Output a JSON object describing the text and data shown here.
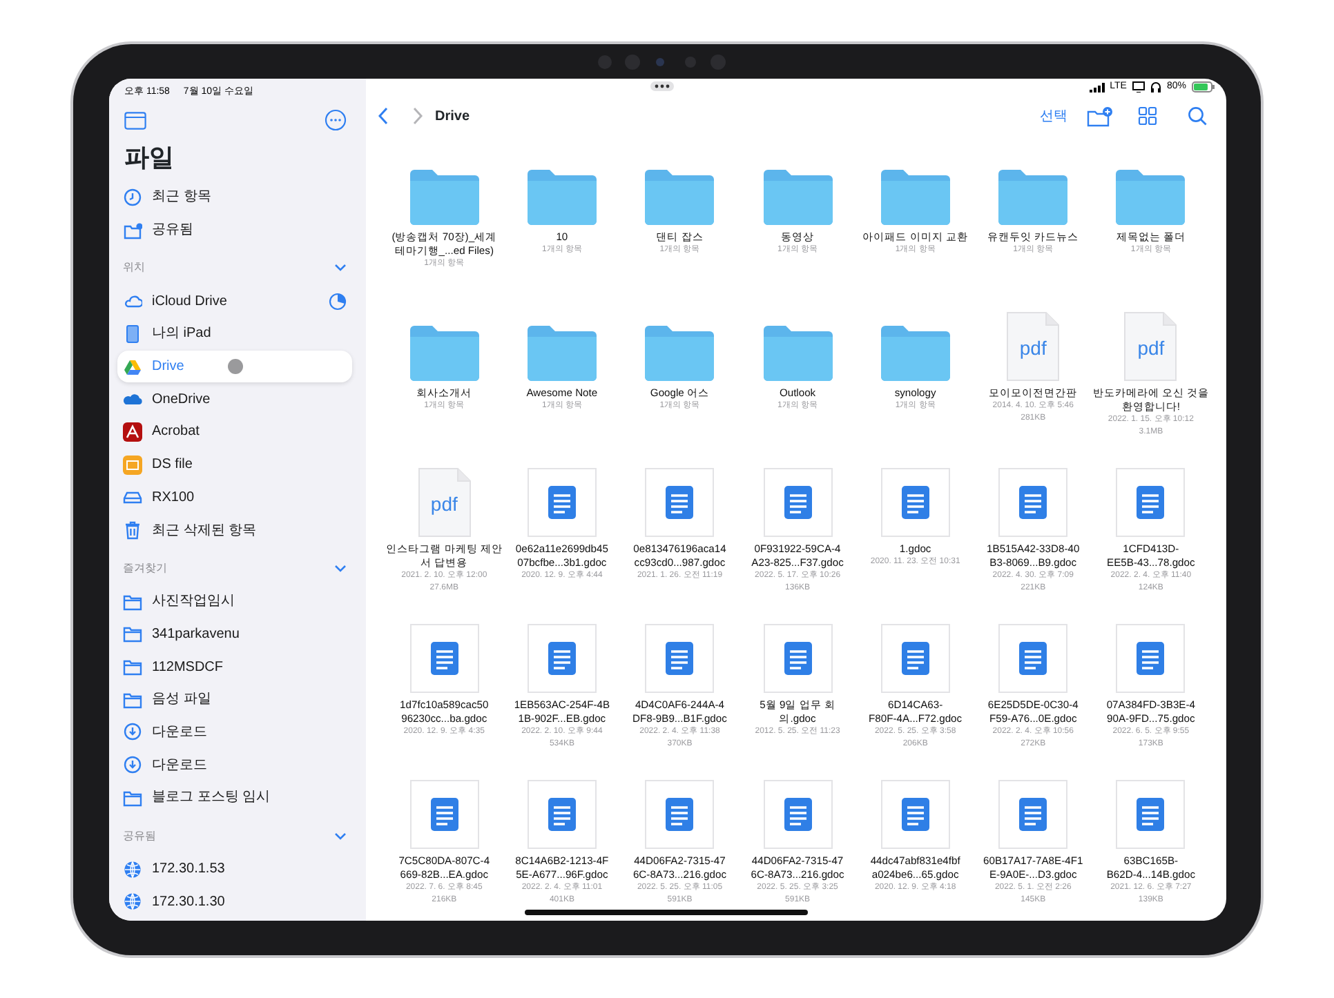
{
  "status_bar": {
    "time": "오후 11:58",
    "date": "7월 10일 수요일",
    "network": "LTE",
    "battery": "80%"
  },
  "sidebar": {
    "title": "파일",
    "top_items": [
      {
        "label": "최근 항목",
        "kind": "clock",
        "selected": false
      },
      {
        "label": "공유됨",
        "kind": "shared",
        "selected": false
      }
    ],
    "sections": [
      {
        "title": "위치",
        "expanded": true,
        "items": [
          {
            "label": "iCloud Drive",
            "kind": "icloud",
            "selected": false
          },
          {
            "label": "나의 iPad",
            "kind": "ipad",
            "selected": false
          },
          {
            "label": "Drive",
            "kind": "gdrive",
            "selected": true
          },
          {
            "label": "OneDrive",
            "kind": "onedrive",
            "selected": false
          },
          {
            "label": "Acrobat",
            "kind": "acrobat",
            "selected": false
          },
          {
            "label": "DS file",
            "kind": "dsfile",
            "selected": false
          },
          {
            "label": "RX100",
            "kind": "disk",
            "selected": false
          },
          {
            "label": "최근 삭제된 항목",
            "kind": "trash",
            "selected": false
          }
        ]
      },
      {
        "title": "즐겨찾기",
        "expanded": true,
        "items": [
          {
            "label": "사진작업임시",
            "kind": "folder",
            "selected": false
          },
          {
            "label": "341parkavenu",
            "kind": "folder",
            "selected": false
          },
          {
            "label": "112MSDCF",
            "kind": "folder",
            "selected": false
          },
          {
            "label": "음성 파일",
            "kind": "folder",
            "selected": false
          },
          {
            "label": "다운로드",
            "kind": "download",
            "selected": false
          },
          {
            "label": "다운로드",
            "kind": "download",
            "selected": false
          },
          {
            "label": "블로그 포스팅 임시",
            "kind": "folder",
            "selected": false
          }
        ]
      },
      {
        "title": "공유됨",
        "expanded": true,
        "items": [
          {
            "label": "172.30.1.53",
            "kind": "globe",
            "selected": false
          },
          {
            "label": "172.30.1.30",
            "kind": "globe",
            "selected": false
          }
        ]
      }
    ]
  },
  "toolbar": {
    "title": "Drive",
    "select_label": "선택"
  },
  "files": [
    {
      "kind": "folder",
      "name_lines": [
        "(방송캡처 70장)_세계",
        "테마기행_...ed Files)"
      ],
      "meta": [
        "1개의 항목"
      ]
    },
    {
      "kind": "folder",
      "name_lines": [
        "10"
      ],
      "meta": [
        "1개의 항목"
      ]
    },
    {
      "kind": "folder",
      "name_lines": [
        "댄티 잡스"
      ],
      "meta": [
        "1개의 항목"
      ]
    },
    {
      "kind": "folder",
      "name_lines": [
        "동영상"
      ],
      "meta": [
        "1개의 항목"
      ]
    },
    {
      "kind": "folder",
      "name_lines": [
        "아이패드 이미지 교환"
      ],
      "meta": [
        "1개의 항목"
      ]
    },
    {
      "kind": "folder",
      "name_lines": [
        "유캔두잇 카드뉴스"
      ],
      "meta": [
        "1개의 항목"
      ]
    },
    {
      "kind": "folder",
      "name_lines": [
        "제목없는 폴더"
      ],
      "meta": [
        "1개의 항목"
      ]
    },
    {
      "kind": "folder",
      "name_lines": [
        "회사소개서"
      ],
      "meta": [
        "1개의 항목"
      ]
    },
    {
      "kind": "folder",
      "name_lines": [
        "Awesome Note"
      ],
      "meta": [
        "1개의 항목"
      ]
    },
    {
      "kind": "folder",
      "name_lines": [
        "Google 어스"
      ],
      "meta": [
        "1개의 항목"
      ]
    },
    {
      "kind": "folder",
      "name_lines": [
        "Outlook"
      ],
      "meta": [
        "1개의 항목"
      ]
    },
    {
      "kind": "folder",
      "name_lines": [
        "synology"
      ],
      "meta": [
        "1개의 항목"
      ]
    },
    {
      "kind": "pdf",
      "icon_label": "pdf",
      "name_lines": [
        "모이모이전면간판"
      ],
      "meta": [
        "2014. 4. 10. 오후 5:46",
        "281KB"
      ]
    },
    {
      "kind": "pdf",
      "icon_label": "pdf",
      "name_lines": [
        "반도카메라에 오신 것을",
        "환영합니다!"
      ],
      "meta": [
        "2022. 1. 15. 오후 10:12",
        "3.1MB"
      ]
    },
    {
      "kind": "pdf",
      "icon_label": "pdf",
      "name_lines": [
        "인스타그램 마케팅 제안",
        "서 답변용"
      ],
      "meta": [
        "2021. 2. 10. 오후 12:00",
        "27.6MB"
      ]
    },
    {
      "kind": "gdoc",
      "name_lines": [
        "0e62a11e2699db45",
        "07bcfbe...3b1.gdoc"
      ],
      "meta": [
        "2020. 12. 9. 오후 4:44"
      ]
    },
    {
      "kind": "gdoc",
      "name_lines": [
        "0e813476196aca14",
        "cc93cd0...987.gdoc"
      ],
      "meta": [
        "2021. 1. 26. 오전 11:19"
      ]
    },
    {
      "kind": "gdoc",
      "name_lines": [
        "0F931922-59CA-4",
        "A23-825...F37.gdoc"
      ],
      "meta": [
        "2022. 5. 17. 오후 10:26",
        "136KB"
      ]
    },
    {
      "kind": "gdoc",
      "name_lines": [
        "1.gdoc"
      ],
      "meta": [
        "2020. 11. 23. 오전 10:31"
      ]
    },
    {
      "kind": "gdoc",
      "name_lines": [
        "1B515A42-33D8-40",
        "B3-8069...B9.gdoc"
      ],
      "meta": [
        "2022. 4. 30. 오후 7:09",
        "221KB"
      ]
    },
    {
      "kind": "gdoc",
      "name_lines": [
        "1CFD413D-",
        "EE5B-43...78.gdoc"
      ],
      "meta": [
        "2022. 2. 4. 오후 11:40",
        "124KB"
      ]
    },
    {
      "kind": "gdoc",
      "name_lines": [
        "1d7fc10a589cac50",
        "96230cc...ba.gdoc"
      ],
      "meta": [
        "2020. 12. 9. 오후 4:35"
      ]
    },
    {
      "kind": "gdoc",
      "name_lines": [
        "1EB563AC-254F-4B",
        "1B-902F...EB.gdoc"
      ],
      "meta": [
        "2022. 2. 10. 오후 9:44",
        "534KB"
      ]
    },
    {
      "kind": "gdoc",
      "name_lines": [
        "4D4C0AF6-244A-4",
        "DF8-9B9...B1F.gdoc"
      ],
      "meta": [
        "2022. 2. 4. 오후 11:38",
        "370KB"
      ]
    },
    {
      "kind": "gdoc",
      "name_lines": [
        "5월 9일 업무 회",
        "의.gdoc"
      ],
      "meta": [
        "2012. 5. 25. 오전 11:23"
      ]
    },
    {
      "kind": "gdoc",
      "name_lines": [
        "6D14CA63-",
        "F80F-4A...F72.gdoc"
      ],
      "meta": [
        "2022. 5. 25. 오후 3:58",
        "206KB"
      ]
    },
    {
      "kind": "gdoc",
      "name_lines": [
        "6E25D5DE-0C30-4",
        "F59-A76...0E.gdoc"
      ],
      "meta": [
        "2022. 2. 4. 오후 10:56",
        "272KB"
      ]
    },
    {
      "kind": "gdoc",
      "name_lines": [
        "07A384FD-3B3E-4",
        "90A-9FD...75.gdoc"
      ],
      "meta": [
        "2022. 6. 5. 오후 9:55",
        "173KB"
      ]
    },
    {
      "kind": "gdoc",
      "name_lines": [
        "7C5C80DA-807C-4",
        "669-82B...EA.gdoc"
      ],
      "meta": [
        "2022. 7. 6. 오후 8:45",
        "216KB"
      ]
    },
    {
      "kind": "gdoc",
      "name_lines": [
        "8C14A6B2-1213-4F",
        "5E-A677...96F.gdoc"
      ],
      "meta": [
        "2022. 2. 4. 오후 11:01",
        "401KB"
      ]
    },
    {
      "kind": "gdoc",
      "name_lines": [
        "44D06FA2-7315-47",
        "6C-8A73...216.gdoc"
      ],
      "meta": [
        "2022. 5. 25. 오후 11:05",
        "591KB"
      ]
    },
    {
      "kind": "gdoc",
      "name_lines": [
        "44D06FA2-7315-47",
        "6C-8A73...216.gdoc"
      ],
      "meta": [
        "2022. 5. 25. 오후 3:25",
        "591KB"
      ]
    },
    {
      "kind": "gdoc",
      "name_lines": [
        "44dc47abf831e4fbf",
        "a024be6...65.gdoc"
      ],
      "meta": [
        "2020. 12. 9. 오후 4:18"
      ]
    },
    {
      "kind": "gdoc",
      "name_lines": [
        "60B17A17-7A8E-4F1",
        "E-9A0E-...D3.gdoc"
      ],
      "meta": [
        "2022. 5. 1. 오전 2:26",
        "145KB"
      ]
    },
    {
      "kind": "gdoc",
      "name_lines": [
        "63BC165B-",
        "B62D-4...14B.gdoc"
      ],
      "meta": [
        "2021. 12. 6. 오후 7:27",
        "139KB"
      ]
    }
  ]
}
